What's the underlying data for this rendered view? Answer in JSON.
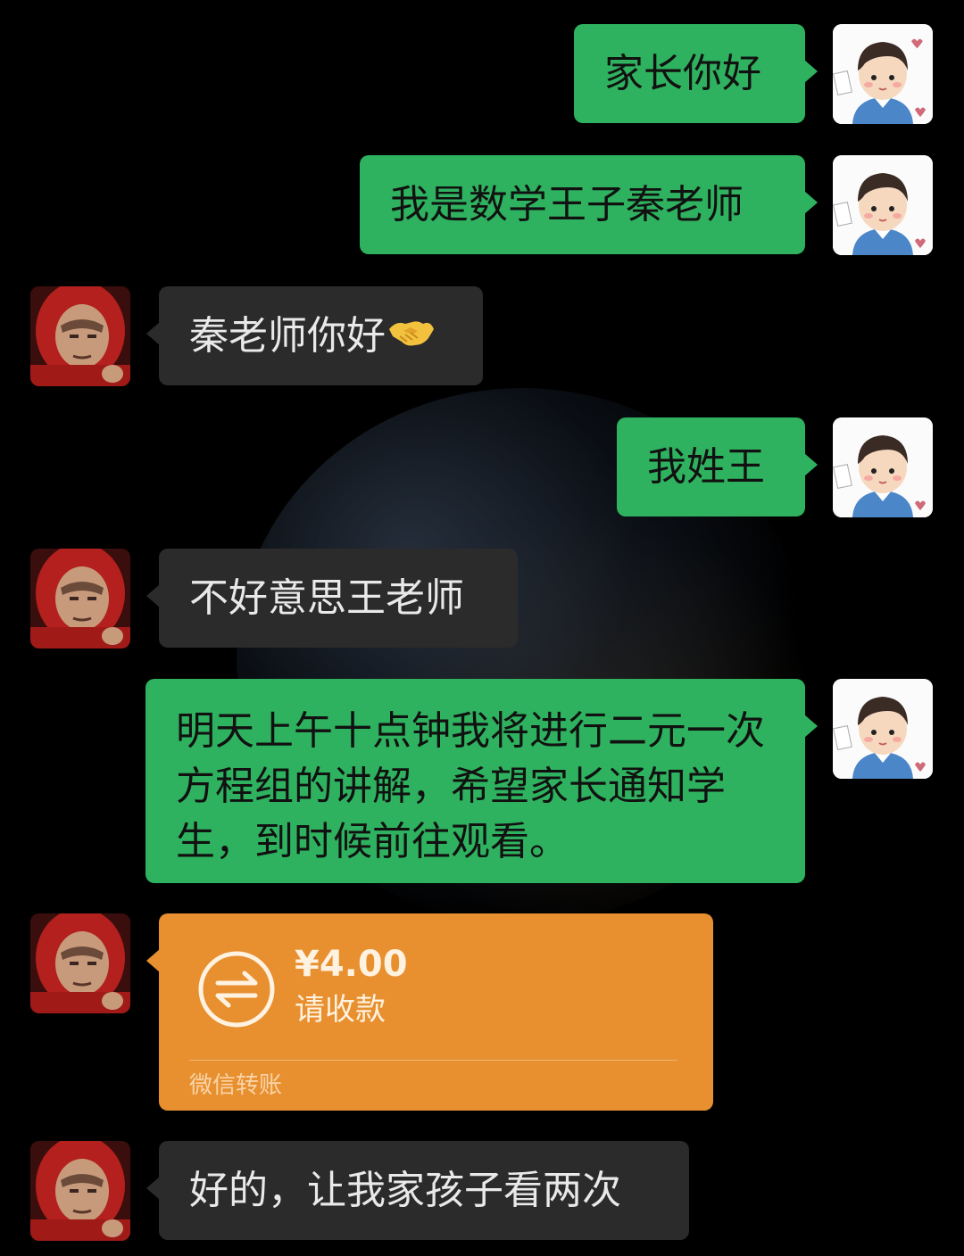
{
  "messages": [
    {
      "side": "right",
      "text": "家长你好"
    },
    {
      "side": "right",
      "text": "我是数学王子秦老师"
    },
    {
      "side": "left",
      "text": "秦老师你好",
      "emoji": "handshake-emoji"
    },
    {
      "side": "right",
      "text": "我姓王"
    },
    {
      "side": "left",
      "text": "不好意思王老师"
    },
    {
      "side": "right",
      "text": "明天上午十点钟我将进行二元一次方程组的讲解，希望家长通知学生，到时候前往观看。"
    },
    {
      "side": "left",
      "type": "transfer",
      "amount": "¥4.00",
      "status": "请收款",
      "footer": "微信转账",
      "icon": "transfer-arrows-icon"
    },
    {
      "side": "left",
      "text": "好的，让我家孩子看两次"
    }
  ],
  "colors": {
    "background": "#000000",
    "outgoing_bubble": "#2fb25f",
    "incoming_bubble": "#2b2b2b",
    "transfer_card": "#e8902f"
  },
  "avatars": {
    "teacher": "cartoon-boy-avatar",
    "parent": "red-hood-man-avatar"
  }
}
